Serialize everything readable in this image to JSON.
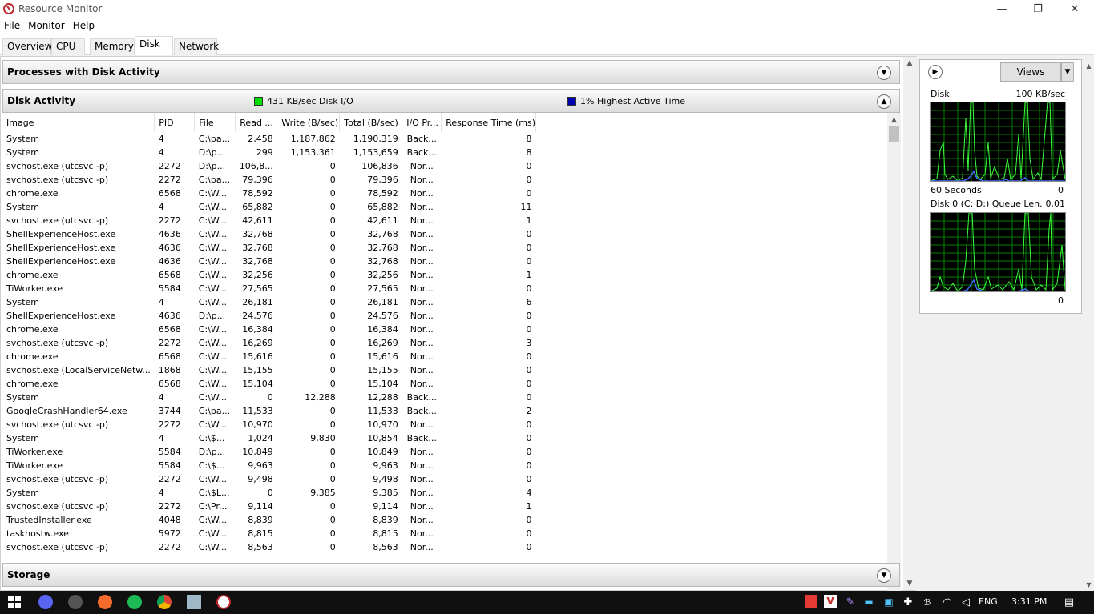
{
  "window": {
    "title": "Resource Monitor",
    "minimize": "—",
    "maximize": "❐",
    "close": "✕"
  },
  "menu": [
    "File",
    "Monitor",
    "Help"
  ],
  "tabs": [
    "Overview",
    "CPU",
    "Memory",
    "Disk",
    "Network"
  ],
  "active_tab": "Disk",
  "sections": {
    "processes": "Processes with Disk Activity",
    "disk": "Disk Activity",
    "storage": "Storage"
  },
  "legend": {
    "io": {
      "text": "431 KB/sec Disk I/O",
      "color": "#00e000"
    },
    "active": {
      "text": "1% Highest Active Time",
      "color": "#0000b0"
    }
  },
  "columns": [
    "Image",
    "PID",
    "File",
    "Read ...",
    "Write (B/sec)",
    "Total (B/sec)",
    "I/O Pr...",
    "Response Time (ms)"
  ],
  "rows": [
    [
      "System",
      "4",
      "C:\\pa...",
      "2,458",
      "1,187,862",
      "1,190,319",
      "Back...",
      "8"
    ],
    [
      "System",
      "4",
      "D:\\p...",
      "299",
      "1,153,361",
      "1,153,659",
      "Back...",
      "8"
    ],
    [
      "svchost.exe (utcsvc -p)",
      "2272",
      "D:\\p...",
      "106,8...",
      "0",
      "106,836",
      "Nor...",
      "0"
    ],
    [
      "svchost.exe (utcsvc -p)",
      "2272",
      "C:\\pa...",
      "79,396",
      "0",
      "79,396",
      "Nor...",
      "0"
    ],
    [
      "chrome.exe",
      "6568",
      "C:\\W...",
      "78,592",
      "0",
      "78,592",
      "Nor...",
      "0"
    ],
    [
      "System",
      "4",
      "C:\\W...",
      "65,882",
      "0",
      "65,882",
      "Nor...",
      "11"
    ],
    [
      "svchost.exe (utcsvc -p)",
      "2272",
      "C:\\W...",
      "42,611",
      "0",
      "42,611",
      "Nor...",
      "1"
    ],
    [
      "ShellExperienceHost.exe",
      "4636",
      "C:\\W...",
      "32,768",
      "0",
      "32,768",
      "Nor...",
      "0"
    ],
    [
      "ShellExperienceHost.exe",
      "4636",
      "C:\\W...",
      "32,768",
      "0",
      "32,768",
      "Nor...",
      "0"
    ],
    [
      "ShellExperienceHost.exe",
      "4636",
      "C:\\W...",
      "32,768",
      "0",
      "32,768",
      "Nor...",
      "0"
    ],
    [
      "chrome.exe",
      "6568",
      "C:\\W...",
      "32,256",
      "0",
      "32,256",
      "Nor...",
      "1"
    ],
    [
      "TiWorker.exe",
      "5584",
      "C:\\W...",
      "27,565",
      "0",
      "27,565",
      "Nor...",
      "0"
    ],
    [
      "System",
      "4",
      "C:\\W...",
      "26,181",
      "0",
      "26,181",
      "Nor...",
      "6"
    ],
    [
      "ShellExperienceHost.exe",
      "4636",
      "D:\\p...",
      "24,576",
      "0",
      "24,576",
      "Nor...",
      "0"
    ],
    [
      "chrome.exe",
      "6568",
      "C:\\W...",
      "16,384",
      "0",
      "16,384",
      "Nor...",
      "0"
    ],
    [
      "svchost.exe (utcsvc -p)",
      "2272",
      "C:\\W...",
      "16,269",
      "0",
      "16,269",
      "Nor...",
      "3"
    ],
    [
      "chrome.exe",
      "6568",
      "C:\\W...",
      "15,616",
      "0",
      "15,616",
      "Nor...",
      "0"
    ],
    [
      "svchost.exe (LocalServiceNetw...",
      "1868",
      "C:\\W...",
      "15,155",
      "0",
      "15,155",
      "Nor...",
      "0"
    ],
    [
      "chrome.exe",
      "6568",
      "C:\\W...",
      "15,104",
      "0",
      "15,104",
      "Nor...",
      "0"
    ],
    [
      "System",
      "4",
      "C:\\W...",
      "0",
      "12,288",
      "12,288",
      "Back...",
      "0"
    ],
    [
      "GoogleCrashHandler64.exe",
      "3744",
      "C:\\pa...",
      "11,533",
      "0",
      "11,533",
      "Back...",
      "2"
    ],
    [
      "svchost.exe (utcsvc -p)",
      "2272",
      "C:\\W...",
      "10,970",
      "0",
      "10,970",
      "Nor...",
      "0"
    ],
    [
      "System",
      "4",
      "C:\\$...",
      "1,024",
      "9,830",
      "10,854",
      "Back...",
      "0"
    ],
    [
      "TiWorker.exe",
      "5584",
      "D:\\p...",
      "10,849",
      "0",
      "10,849",
      "Nor...",
      "0"
    ],
    [
      "TiWorker.exe",
      "5584",
      "C:\\$...",
      "9,963",
      "0",
      "9,963",
      "Nor...",
      "0"
    ],
    [
      "svchost.exe (utcsvc -p)",
      "2272",
      "C:\\W...",
      "9,498",
      "0",
      "9,498",
      "Nor...",
      "0"
    ],
    [
      "System",
      "4",
      "C:\\$L...",
      "0",
      "9,385",
      "9,385",
      "Nor...",
      "4"
    ],
    [
      "svchost.exe (utcsvc -p)",
      "2272",
      "C:\\Pr...",
      "9,114",
      "0",
      "9,114",
      "Nor...",
      "1"
    ],
    [
      "TrustedInstaller.exe",
      "4048",
      "C:\\W...",
      "8,839",
      "0",
      "8,839",
      "Nor...",
      "0"
    ],
    [
      "taskhostw.exe",
      "5972",
      "C:\\W...",
      "8,815",
      "0",
      "8,815",
      "Nor...",
      "0"
    ],
    [
      "svchost.exe (utcsvc -p)",
      "2272",
      "C:\\W...",
      "8,563",
      "0",
      "8,563",
      "Nor...",
      "0"
    ]
  ],
  "side": {
    "views": "Views",
    "graph1": {
      "label": "Disk",
      "max": "100 KB/sec",
      "footer_left": "60 Seconds",
      "footer_right": "0"
    },
    "graph2": {
      "label": "Disk 0 (C: D:) Queue Len...",
      "max": "0.01",
      "footer_right": "0"
    }
  },
  "taskbar": {
    "lang": "ENG",
    "time": "3:31 PM",
    "icons": [
      "windows-start-icon",
      "discord-icon",
      "steam-icon",
      "origin-icon",
      "spotify-icon",
      "chrome-icon",
      "monitor-app-icon",
      "resource-monitor-icon"
    ]
  }
}
